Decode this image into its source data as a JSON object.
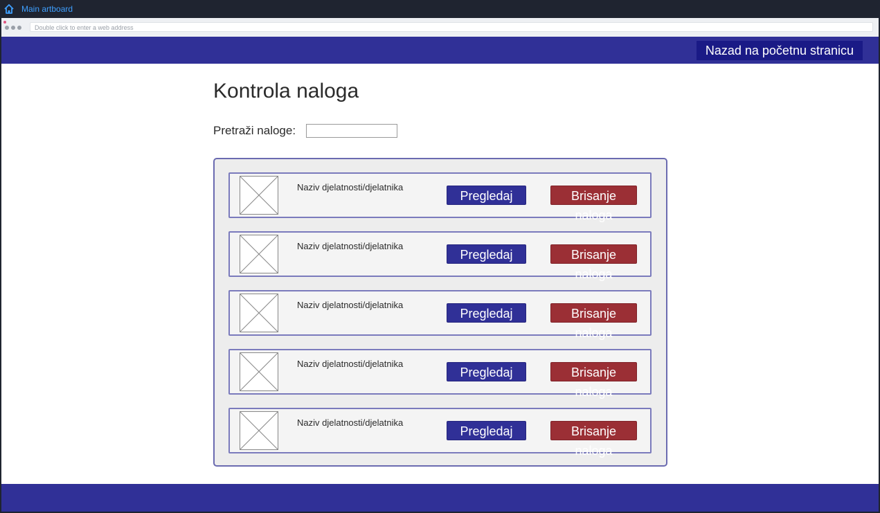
{
  "app": {
    "artboard_title": "Main artboard"
  },
  "browser": {
    "address_placeholder": "Double click to enter a web address"
  },
  "header": {
    "back_button": "Nazad na početnu stranicu"
  },
  "main": {
    "title": "Kontrola naloga",
    "search_label": "Pretraži naloge:",
    "search_value": ""
  },
  "rows": [
    {
      "name": "Naziv djelatnosti/djelatnika",
      "view": "Pregledaj",
      "delete": "Brisanje naloga"
    },
    {
      "name": "Naziv djelatnosti/djelatnika",
      "view": "Pregledaj",
      "delete": "Brisanje naloga"
    },
    {
      "name": "Naziv djelatnosti/djelatnika",
      "view": "Pregledaj",
      "delete": "Brisanje naloga"
    },
    {
      "name": "Naziv djelatnosti/djelatnika",
      "view": "Pregledaj",
      "delete": "Brisanje naloga"
    },
    {
      "name": "Naziv djelatnosti/djelatnika",
      "view": "Pregledaj",
      "delete": "Brisanje naloga"
    }
  ],
  "colors": {
    "header_bg": "#303097",
    "view_button": "#303097",
    "delete_button": "#9b2f35",
    "accent_link": "#3fa0ff"
  },
  "icons": {
    "home": "home-icon",
    "placeholder": "image-placeholder-icon"
  }
}
